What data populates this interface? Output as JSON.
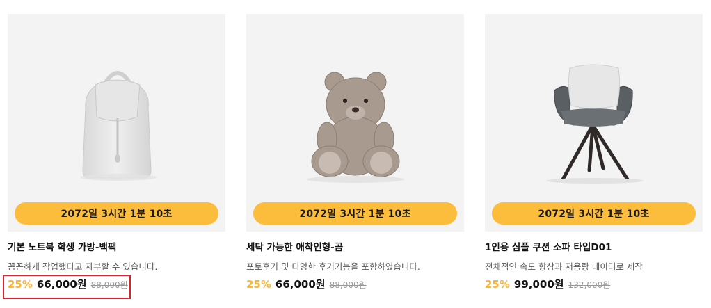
{
  "products": [
    {
      "timer": "2072일 3시간 1분 10초",
      "title": "기본 노트북 학생 가방-백팩",
      "description": "꼼꼼하게 작업했다고 자부할 수 있습니다.",
      "discount": "25%",
      "price": "66,000원",
      "original_price": "88,000원",
      "image": "backpack"
    },
    {
      "timer": "2072일 3시간 1분 10초",
      "title": "세탁 가능한 애착인형-곰",
      "description": "포토후기 및 다양한 후기기능을 포함하였습니다.",
      "discount": "25%",
      "price": "66,000원",
      "original_price": "88,000원",
      "image": "teddy-bear"
    },
    {
      "timer": "2072일 3시간 1분 10초",
      "title": "1인용 심플 쿠션 소파 타입D01",
      "description": "전체적인 속도 향상과 저용량 데이터로 제작",
      "discount": "25%",
      "price": "99,000원",
      "original_price": "132,000원",
      "image": "chair"
    }
  ],
  "colors": {
    "timer_bg": "#fdbd3c",
    "discount": "#fdb533",
    "highlight_border": "#e0212b"
  }
}
